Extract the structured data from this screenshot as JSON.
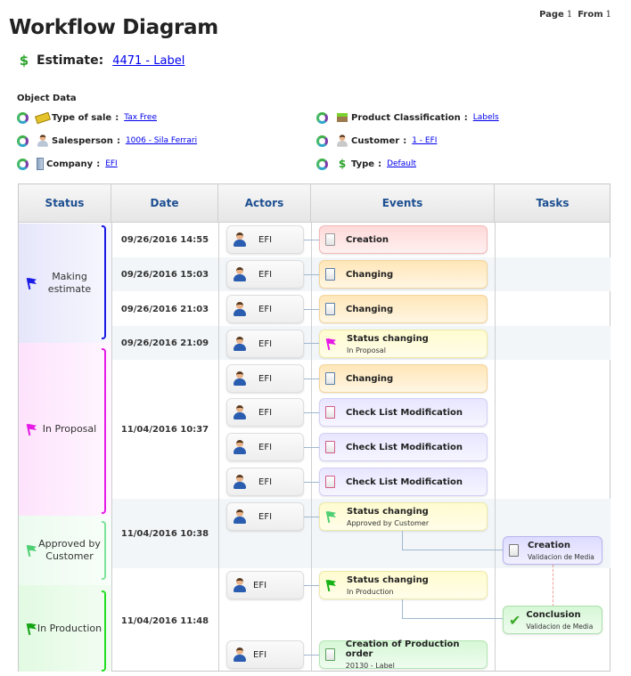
{
  "pager": {
    "page_label": "Page",
    "page": "1",
    "from_label": "From",
    "total": "1"
  },
  "title": "Workflow Diagram",
  "estimate": {
    "icon": "dollar-document-icon",
    "label": "Estimate:",
    "value": "4471 - Label"
  },
  "object_data": {
    "title": "Object Data",
    "items": [
      {
        "key": "Type of sale",
        "value": "Tax Free",
        "icon": "ticket-icon"
      },
      {
        "key": "Salesperson",
        "value": "1006 - Sila Ferrari",
        "icon": "person-icon"
      },
      {
        "key": "Company",
        "value": "EFI",
        "icon": "building-icon"
      },
      {
        "key": "Product Classification",
        "value": "Labels",
        "icon": "box-icon"
      },
      {
        "key": "Customer",
        "value": "1 - EFI",
        "icon": "people-icon"
      },
      {
        "key": "Type",
        "value": "Default",
        "icon": "dollar-icon"
      }
    ]
  },
  "table": {
    "headers": [
      "Status",
      "Date",
      "Actors",
      "Events",
      "Tasks"
    ],
    "statuses": [
      {
        "label": "Making estimate",
        "color": "#1a1ae6",
        "bg": "#ebebfc"
      },
      {
        "label": "In Proposal",
        "color": "#e61ae6",
        "bg": "#fde8fc"
      },
      {
        "label": "Approved by Customer",
        "color": "#7be39a",
        "bg": "#effcf1"
      },
      {
        "label": "In Production",
        "color": "#22dd22",
        "bg": "#e6fbe6"
      }
    ],
    "dates": [
      "09/26/2016 14:55",
      "09/26/2016 15:03",
      "09/26/2016 21:03",
      "09/26/2016 21:09",
      "11/04/2016 10:37",
      "11/04/2016 10:38",
      "11/04/2016 11:48"
    ],
    "actors": [
      "EFI",
      "EFI",
      "EFI",
      "EFI",
      "EFI",
      "EFI",
      "EFI",
      "EFI",
      "EFI",
      "EFI",
      "EFI"
    ],
    "events": [
      {
        "title": "Creation",
        "sub": "",
        "icon": "document-icon",
        "color": "red"
      },
      {
        "title": "Changing",
        "sub": "",
        "icon": "edit-document-icon",
        "color": "orange"
      },
      {
        "title": "Changing",
        "sub": "",
        "icon": "edit-document-icon",
        "color": "orange"
      },
      {
        "title": "Status changing",
        "sub": "In Proposal",
        "icon": "flag-icon",
        "color": "yellow"
      },
      {
        "title": "Changing",
        "sub": "",
        "icon": "edit-document-icon",
        "color": "orange"
      },
      {
        "title": "Check List Modification",
        "sub": "",
        "icon": "checklist-icon",
        "color": "purple"
      },
      {
        "title": "Check List Modification",
        "sub": "",
        "icon": "checklist-icon",
        "color": "purple"
      },
      {
        "title": "Check List Modification",
        "sub": "",
        "icon": "checklist-icon",
        "color": "purple"
      },
      {
        "title": "Status changing",
        "sub": "Approved by Customer",
        "icon": "flag-icon",
        "color": "yellow"
      },
      {
        "title": "Status changing",
        "sub": "In Production",
        "icon": "flag-icon",
        "color": "yellow"
      },
      {
        "title": "Creation of Production order",
        "sub": "20130 - Label",
        "icon": "production-order-icon",
        "color": "green"
      }
    ],
    "tasks": [
      {
        "title": "Creation",
        "sub": "Validacion de Media",
        "icon": "document-icon"
      },
      {
        "title": "Conclusion",
        "sub": "Validacion de Media",
        "icon": "checkmark-icon"
      }
    ]
  }
}
